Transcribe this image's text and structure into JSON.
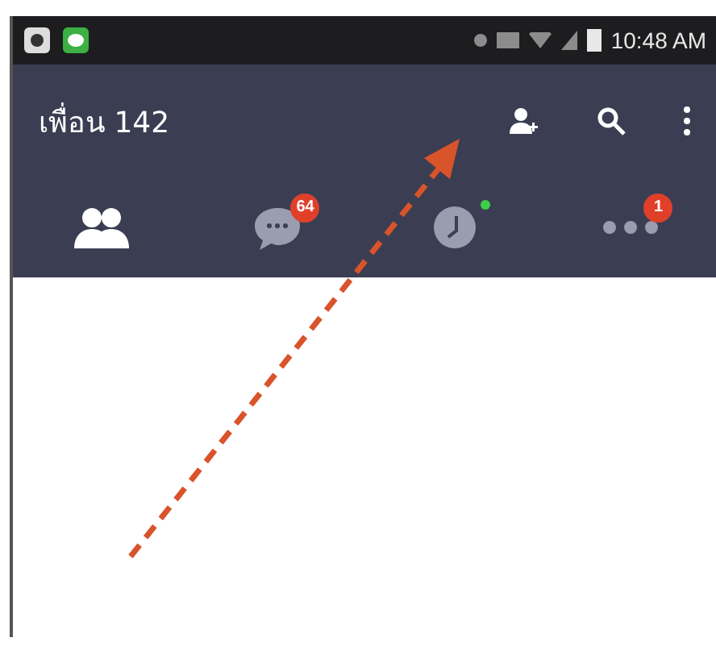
{
  "status_bar": {
    "time": "10:48 AM"
  },
  "app_bar": {
    "title": "เพื่อน 142"
  },
  "tabs": [
    {
      "kind": "friends",
      "selected": true
    },
    {
      "kind": "chats",
      "selected": false,
      "badge": "64"
    },
    {
      "kind": "timeline",
      "selected": false,
      "new_dot": true
    },
    {
      "kind": "more",
      "selected": false,
      "badge": "1"
    }
  ],
  "annotation": {
    "kind": "arrow"
  }
}
